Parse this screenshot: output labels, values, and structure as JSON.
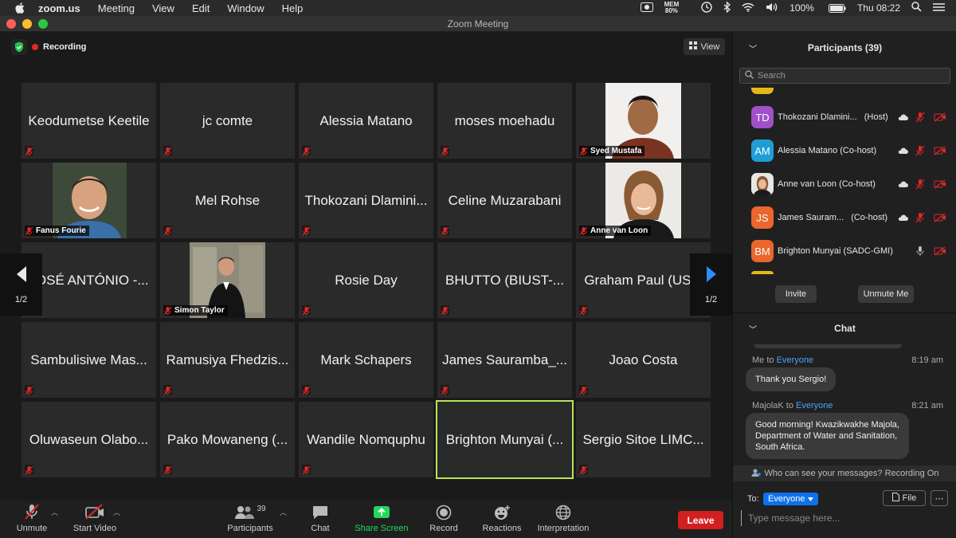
{
  "menubar": {
    "app": "zoom.us",
    "items": [
      "Meeting",
      "View",
      "Edit",
      "Window",
      "Help"
    ],
    "mem_label": "MEM",
    "mem_value": "80%",
    "battery": "100%",
    "clock": "Thu 08:22"
  },
  "window": {
    "title": "Zoom Meeting"
  },
  "meeting": {
    "recording_label": "Recording",
    "view_label": "View",
    "page_indicator": "1/2"
  },
  "tiles": [
    {
      "name": "Keodumetse Keetile",
      "video": false
    },
    {
      "name": "jc comte",
      "video": false
    },
    {
      "name": "Alessia Matano",
      "video": false
    },
    {
      "name": "moses moehadu",
      "video": false
    },
    {
      "name": "Syed Mustafa",
      "video": true
    },
    {
      "name": "Fanus Fourie",
      "video": true
    },
    {
      "name": "Mel Rohse",
      "video": false
    },
    {
      "name": "Thokozani Dlamini...",
      "video": false
    },
    {
      "name": "Celine Muzarabani",
      "video": false
    },
    {
      "name": "Anne van Loon",
      "video": true
    },
    {
      "name": "JOSÉ ANTÓNIO -...",
      "video": false
    },
    {
      "name": "Simon Taylor",
      "video": true
    },
    {
      "name": "Rosie Day",
      "video": false
    },
    {
      "name": "BHUTTO (BIUST-...",
      "video": false
    },
    {
      "name": "Graham Paul (US...",
      "video": false
    },
    {
      "name": "Sambulisiwe Mas...",
      "video": false
    },
    {
      "name": "Ramusiya Fhedzis...",
      "video": false
    },
    {
      "name": "Mark Schapers",
      "video": false
    },
    {
      "name": "James Sauramba_...",
      "video": false
    },
    {
      "name": "Joao Costa",
      "video": false
    },
    {
      "name": "Oluwaseun Olabo...",
      "video": false
    },
    {
      "name": "Pako Mowaneng (...",
      "video": false
    },
    {
      "name": "Wandile Nomquphu",
      "video": false
    },
    {
      "name": "Brighton Munyai (...",
      "video": false,
      "active": true
    },
    {
      "name": "Sergio Sitoe LIMC...",
      "video": false
    }
  ],
  "toolbar": {
    "unmute": "Unmute",
    "start_video": "Start Video",
    "participants": "Participants",
    "participants_count": "39",
    "chat": "Chat",
    "share_screen": "Share Screen",
    "record": "Record",
    "reactions": "Reactions",
    "interpretation": "Interpretation",
    "leave": "Leave"
  },
  "participants_panel": {
    "title": "Participants (39)",
    "search_placeholder": "Search",
    "rows": [
      {
        "initials": "TD",
        "name": "Thokozani Dlamini...",
        "role": "(Host)",
        "color": "#a050c8",
        "mic": "muted"
      },
      {
        "initials": "AM",
        "name": "Alessia Matano (Co-host)",
        "role": "",
        "color": "#1f9ed6",
        "mic": "muted"
      },
      {
        "initials": "",
        "name": "Anne van Loon (Co-host)",
        "role": "",
        "color": "#888888",
        "mic": "muted",
        "photo": true
      },
      {
        "initials": "JS",
        "name": "James Sauram...",
        "role": "(Co-host)",
        "color": "#e9662c",
        "mic": "muted"
      },
      {
        "initials": "BM",
        "name": "Brighton Munyai (SADC-GMI)",
        "role": "",
        "color": "#e9662c",
        "mic": "on"
      }
    ],
    "invite": "Invite",
    "unmute_me": "Unmute Me"
  },
  "chat_panel": {
    "title": "Chat",
    "messages": [
      {
        "from": "Me to ",
        "to": "Everyone",
        "time": "8:19 am",
        "text": "Thank you Sergio!"
      },
      {
        "from": "MajolaK to ",
        "to": "Everyone",
        "time": "8:21 am",
        "lines": [
          "Good morning! Kwazikwakhe Majola,",
          "Department of Water and Sanitation,",
          "South Africa."
        ]
      }
    ],
    "notice": "Who can see your messages? Recording On",
    "to_label": "To:",
    "to_value": "Everyone",
    "file_label": "File",
    "input_placeholder": "Type message here..."
  },
  "colors": {
    "accent": "#0e71eb",
    "leave": "#d21f1f",
    "active_speaker": "#b9e35a",
    "share": "#23d959"
  }
}
